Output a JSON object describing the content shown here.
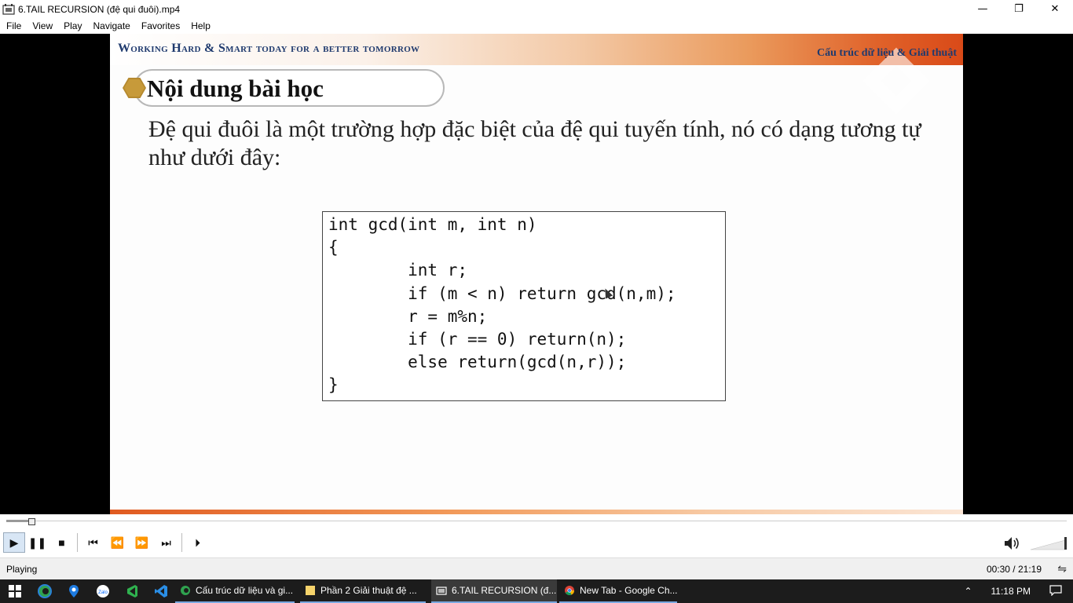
{
  "window": {
    "title": "6.TAIL RECURSION (đệ qui đuôi).mp4",
    "minimize": "—",
    "restore": "❐",
    "close": "✕"
  },
  "menu": [
    "File",
    "View",
    "Play",
    "Navigate",
    "Favorites",
    "Help"
  ],
  "slide": {
    "motto": "Working Hard & Smart today for a better tomorrow",
    "course": "Cấu trúc dữ liệu & Giải thuật",
    "section_title": "Nội dung bài học",
    "body": "Đệ qui đuôi là một trường hợp đặc biệt của đệ qui tuyến tính, nó có dạng tương tự như dưới đây:",
    "code": [
      "int gcd(int m, int n)",
      "{",
      "        int r;",
      "        if (m < n) return gcd(n,m);",
      "        r = m%n;",
      "        if (r == 0) return(n);",
      "        else return(gcd(n,r));",
      "}"
    ]
  },
  "player": {
    "progress_fraction": 0.0236,
    "controls": {
      "play": "▶",
      "pause": "❚❚",
      "stop": "■",
      "prev": "⏮",
      "rewind": "⏪",
      "forward": "⏩",
      "next": "⏭",
      "frame_step": "⏵"
    },
    "status": "Playing",
    "time": "00:30 / 21:19"
  },
  "taskbar": {
    "apps": [
      {
        "label": "Cấu trúc dữ liệu và gi...",
        "active": false
      },
      {
        "label": "Phần 2 Giải thuật đệ ...",
        "active": false
      },
      {
        "label": "6.TAIL RECURSION (đ...",
        "active": true
      },
      {
        "label": "New Tab - Google Ch...",
        "active": false
      }
    ],
    "clock": "11:18 PM"
  },
  "colors": {
    "header_orange": "#e0622a",
    "title_blue": "#1f3a6e",
    "taskbar_bg": "#1c1c1c"
  }
}
